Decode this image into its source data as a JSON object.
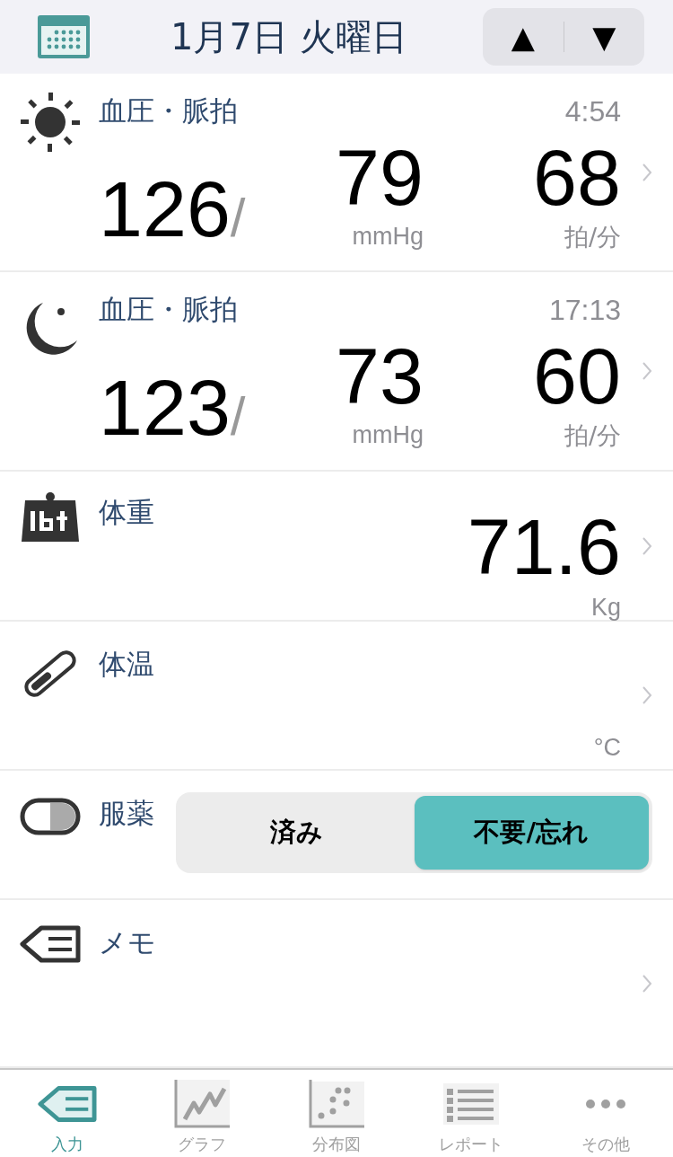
{
  "header": {
    "date": "1月7日 火曜日",
    "prev": "▲",
    "next": "▼"
  },
  "entries": [
    {
      "kind": "bp_morning",
      "label": "血圧・脈拍",
      "time": "4:54",
      "systolic": "126",
      "slash": "/",
      "diastolic": "79",
      "pressure_unit": "mmHg",
      "pulse": "68",
      "pulse_unit": "拍/分"
    },
    {
      "kind": "bp_evening",
      "label": "血圧・脈拍",
      "time": "17:13",
      "systolic": "123",
      "slash": "/",
      "diastolic": "73",
      "pressure_unit": "mmHg",
      "pulse": "60",
      "pulse_unit": "拍/分"
    },
    {
      "kind": "weight",
      "label": "体重",
      "value": "71.6",
      "unit": "Kg"
    },
    {
      "kind": "temperature",
      "label": "体温",
      "unit": "°C"
    },
    {
      "kind": "medication",
      "label": "服薬",
      "options": [
        {
          "label": "済み",
          "selected": false
        },
        {
          "label": "不要/忘れ",
          "selected": true
        }
      ]
    },
    {
      "kind": "memo",
      "label": "メモ"
    }
  ],
  "tabs": [
    {
      "kind": "input",
      "label": "入力",
      "selected": true
    },
    {
      "kind": "graph",
      "label": "グラフ",
      "selected": false
    },
    {
      "kind": "scatter",
      "label": "分布図",
      "selected": false
    },
    {
      "kind": "report",
      "label": "レポート",
      "selected": false
    },
    {
      "kind": "more",
      "label": "その他",
      "selected": false
    }
  ]
}
